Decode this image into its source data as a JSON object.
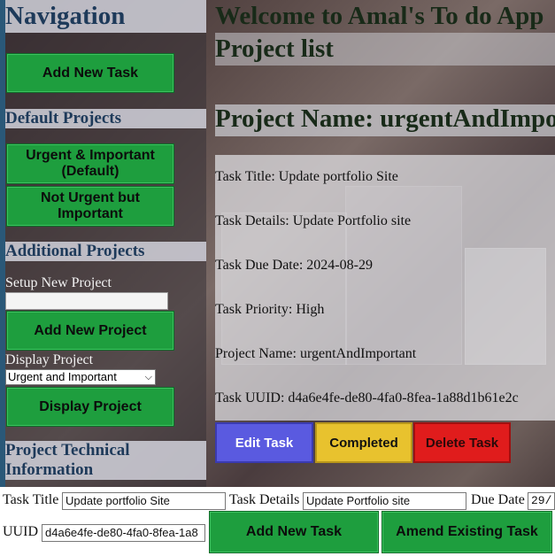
{
  "sidebar": {
    "navigation_heading": "Navigation",
    "add_new_task": "Add New Task",
    "default_projects_heading": "Default Projects",
    "urgent_important": "Urgent & Important (Default)",
    "not_urgent_important": "Not Urgent but Important",
    "additional_projects_heading": "Additional Projects",
    "setup_new_project_label": "Setup New Project",
    "setup_new_project_value": "",
    "add_new_project": "Add New Project",
    "display_project_label": "Display Project",
    "display_project_selected": "Urgent and Important",
    "display_project_button": "Display Project",
    "technical_heading": "Project Technical Information"
  },
  "main": {
    "welcome": "Welcome to Amal's To do App",
    "project_list": "Project list",
    "project_name_heading": "Project Name: urgentAndImportant",
    "task": {
      "title": "Task Title: Update portfolio Site",
      "details": "Task Details: Update Portfolio site",
      "due_date": "Task Due Date: 2024-08-29",
      "priority": "Task Priority: High",
      "project_name": "Project Name: urgentAndImportant",
      "uuid": "Task UUID: d4a6e4fe-de80-4fa0-8fea-1a88d1b61e2c"
    },
    "edit_task": "Edit Task",
    "completed": "Completed",
    "delete_task": "Delete Task"
  },
  "footer": {
    "task_title_label": "Task Title",
    "task_title_value": "Update portfolio Site",
    "task_details_label": "Task Details",
    "task_details_value": "Update Portfolio site",
    "due_date_label": "Due Date",
    "due_date_value": "29/",
    "uuid_label": "UUID",
    "uuid_value": "d4a6e4fe-de80-4fa0-8fea-1a8",
    "add_new_task": "Add New Task",
    "amend_existing_task": "Amend Existing Task"
  }
}
